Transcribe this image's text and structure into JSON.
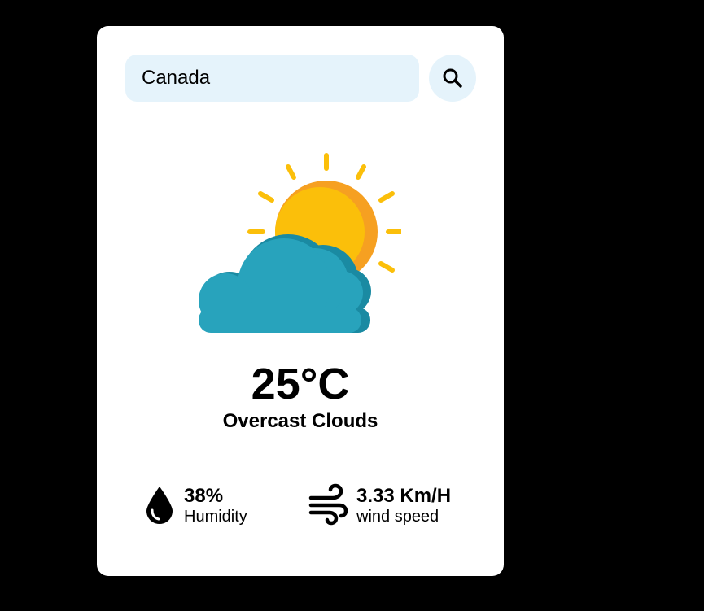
{
  "search": {
    "value": "Canada",
    "button_icon": "search-icon"
  },
  "weather": {
    "icon": "sun-behind-cloud-icon",
    "temperature": "25°C",
    "description": "Overcast Clouds"
  },
  "humidity": {
    "icon": "water-drop-icon",
    "value": "38%",
    "label": "Humidity"
  },
  "wind": {
    "icon": "wind-icon",
    "value": "3.33 Km/H",
    "label": "wind speed"
  },
  "colors": {
    "page_background": "#000000",
    "card_background": "#ffffff",
    "input_background": "#e5f3fb",
    "sun": "#fbbf0a",
    "sun_shadow": "#f6a021",
    "cloud": "#28a3bc",
    "cloud_shadow": "#1a8aa2"
  }
}
